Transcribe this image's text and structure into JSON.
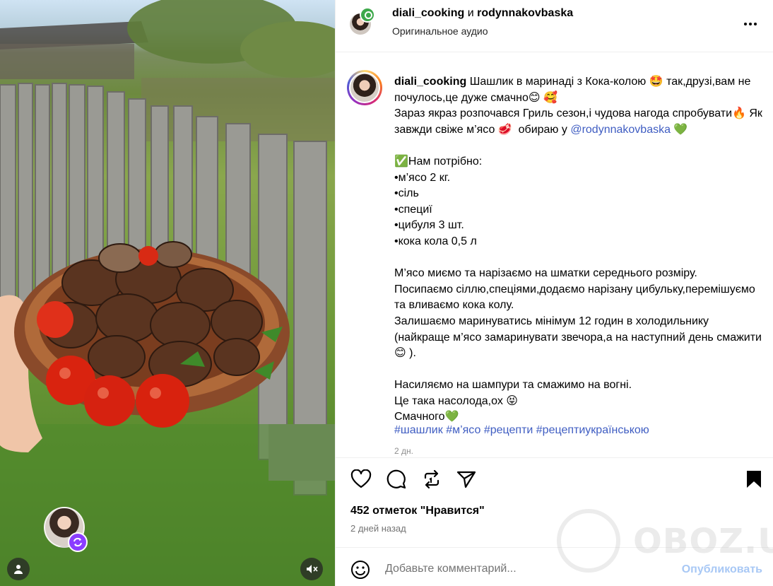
{
  "media": {
    "description_icons": [
      "user-icon",
      "muted-speaker-icon",
      "remix-icon"
    ]
  },
  "header": {
    "author1": "diali_cooking",
    "and_word": "и",
    "author2": "rodynnakovbaska",
    "audio": "Оригинальное аудио"
  },
  "caption": {
    "username": "diali_cooking",
    "line1": " Шашлик в маринаді з Кока-колою 🤩 так,друзі,вам не почулось,це дуже смачно😊 🥰\nЗараз якраз розпочався Гриль сезон,і чудова нагода спробувати🔥 Як завжди свіже м’ясо 🥩  обираю у ",
    "mention": "@rodynnakovbaska",
    "line2": " 💚\n\n✅Нам потрібно:\n•м’ясо 2 кг.\n•сіль\n•специї\n•цибуля 3 шт.\n•кока кола 0,5 л\n\nМ’ясо миємо та нарізаємо на шматки середнього розміру.\nПосипаємо сіллю,спеціями,додаємо нарізану цибульку,перемішуємо та вливаємо кока колу.\nЗалишаємо маринуватись мінімум 12 годин в холодильнику (найкраще м’ясо замаринувати звечора,а на наступний день смажити😊 ).\n\nНасиляємо на шампури та смажимо на вогні.\nЦе така насолода,ох 😝\nСмачного💚",
    "hashtags": "#шашлик #м’ясо #рецепти #рецептиукраїнською",
    "time": "2 дн."
  },
  "likes": "452 отметок \"Нравится\"",
  "date": "2 дней назад",
  "comment": {
    "placeholder": "Добавьте комментарий...",
    "publish": "Опубликовать"
  },
  "watermark": "OBOZ.UA"
}
